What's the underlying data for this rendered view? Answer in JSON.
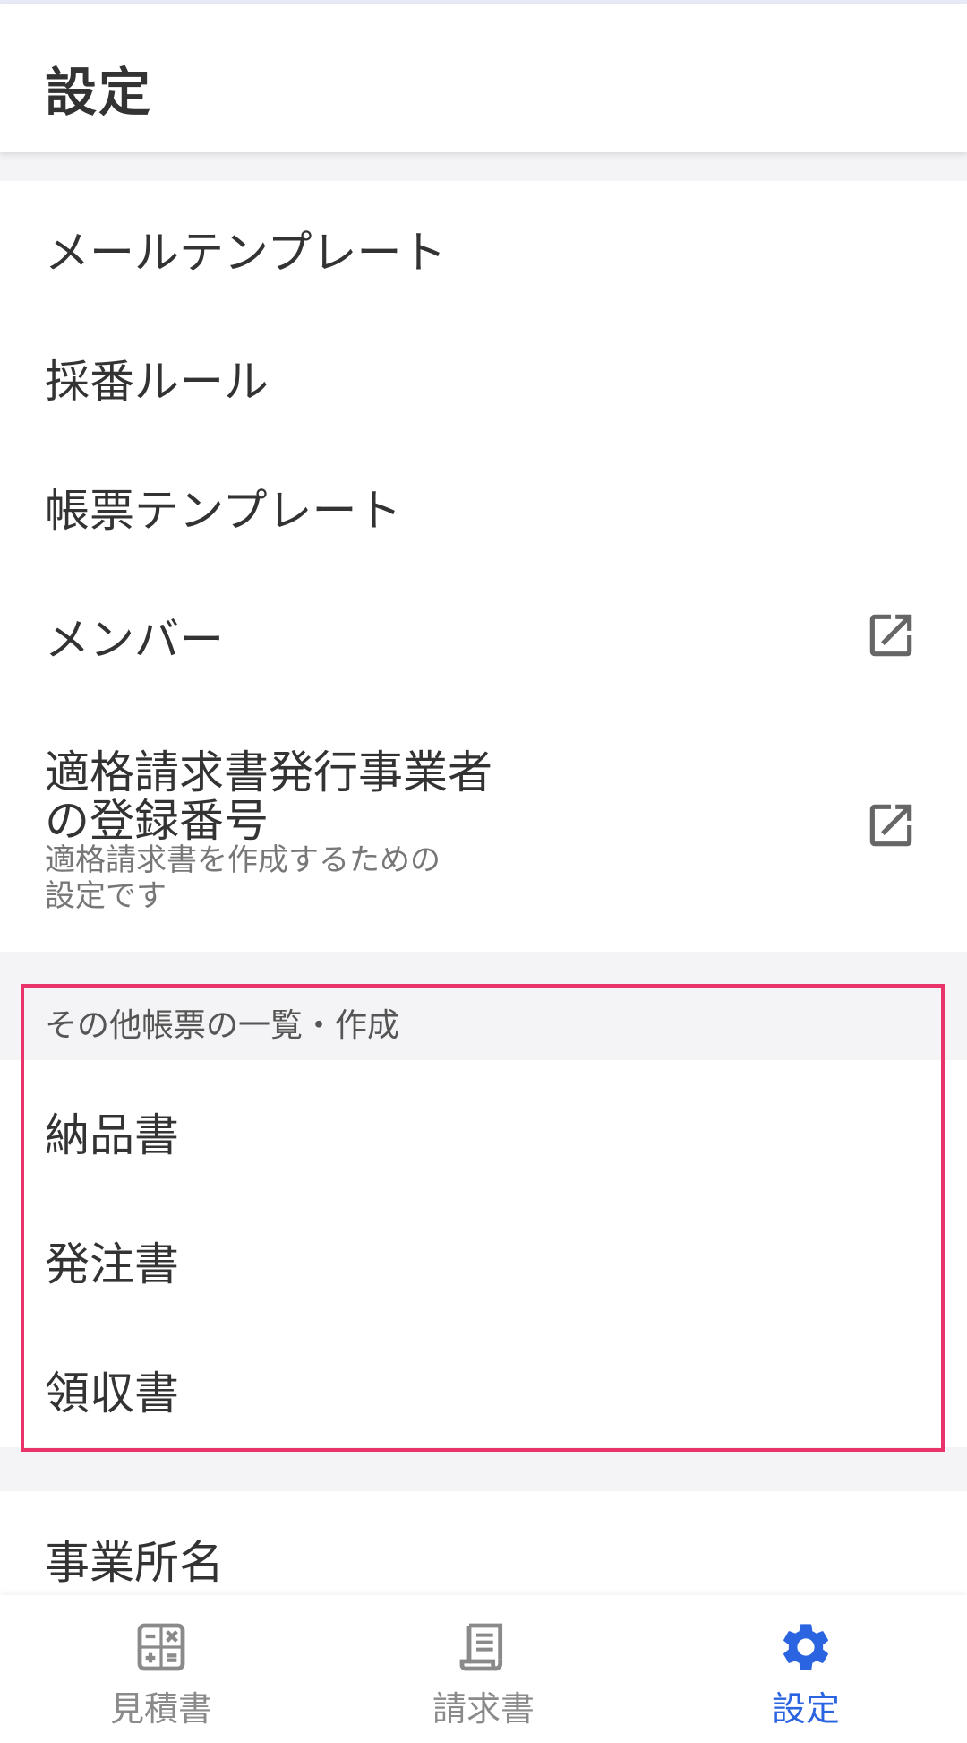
{
  "header": {
    "title": "設定"
  },
  "settings": {
    "mail_template": "メールテンプレート",
    "numbering_rule": "採番ルール",
    "document_template": "帳票テンプレート",
    "members": "メンバー",
    "invoice_registration_line1": "適格請求書発行事業者",
    "invoice_registration_line2": "の登録番号",
    "invoice_registration_desc_line1": "適格請求書を作成するための",
    "invoice_registration_desc_line2": "設定です"
  },
  "other_documents": {
    "header": "その他帳票の一覧・作成",
    "items": [
      "納品書",
      "発注書",
      "領収書"
    ]
  },
  "business": {
    "office_name": "事業所名"
  },
  "bottom_nav": {
    "items": [
      {
        "label": "見積書",
        "icon": "calculator-icon",
        "active": false
      },
      {
        "label": "請求書",
        "icon": "receipt-icon",
        "active": false
      },
      {
        "label": "設定",
        "icon": "gear-icon",
        "active": true
      }
    ]
  },
  "colors": {
    "accent": "#2a64e0",
    "highlight_border": "#e8336b",
    "inactive_nav": "#8a8a8a",
    "icon_gray": "#666666"
  }
}
